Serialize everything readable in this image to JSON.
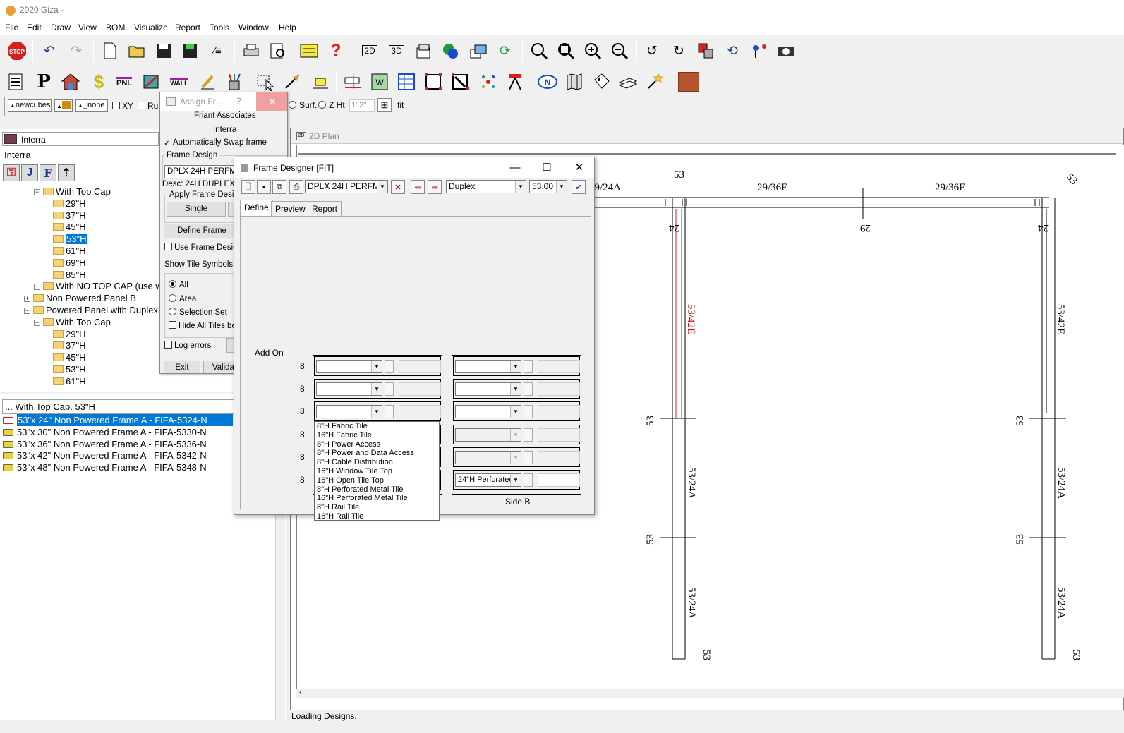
{
  "app": {
    "title": "2020 Giza -"
  },
  "menu": [
    "File",
    "Edit",
    "Draw",
    "View",
    "BOM",
    "Visualize",
    "Report",
    "Tools",
    "Window",
    "Help"
  ],
  "toolbar_icons": [
    "stop-icon",
    "undo-icon",
    "redo-icon",
    "new-icon",
    "open-icon",
    "save-icon",
    "save-as-icon",
    "properties-icon",
    "print-icon",
    "print-preview-icon",
    "notes-icon",
    "help-icon",
    "view-2d-icon",
    "view-3d-icon",
    "layers-icon",
    "globe-icon",
    "windows-icon",
    "refresh-icon",
    "zoom-window-icon",
    "zoom-extents-icon",
    "zoom-in-icon",
    "zoom-out-icon",
    "rotate-left-icon",
    "rotate-right-icon",
    "flip-icon",
    "orbit-icon",
    "pin-icon",
    "snapshot-icon"
  ],
  "toolbar2": {
    "pnl_label": "PNL",
    "wall_label": "WALL",
    "p_label": "P",
    "s_label": "$"
  },
  "layerbar": {
    "layer1": "newcubes",
    "layer3": "_none",
    "xy": "XY",
    "rule": "Rule",
    "surf": "Surf.",
    "zht": "Z Ht",
    "zht_value": "1' 3\"",
    "fit": "fit"
  },
  "left": {
    "combo_value": "Interra",
    "label": "Interra",
    "tree": [
      {
        "text": "With Top Cap",
        "indent": 3,
        "type": "expanded"
      },
      {
        "text": "29\"H",
        "indent": 4
      },
      {
        "text": "37\"H",
        "indent": 4
      },
      {
        "text": "45\"H",
        "indent": 4
      },
      {
        "text": "53\"H",
        "indent": 4,
        "selected": true
      },
      {
        "text": "61\"H",
        "indent": 4
      },
      {
        "text": "69\"H",
        "indent": 4
      },
      {
        "text": "85\"H",
        "indent": 4
      },
      {
        "text": "With NO TOP CAP (use w",
        "indent": 3,
        "type": "collapsed"
      },
      {
        "text": "Non Powered Panel B",
        "indent": 2,
        "type": "collapsed"
      },
      {
        "text": "Powered Panel with Duplex",
        "indent": 2,
        "type": "expanded"
      },
      {
        "text": "With Top Cap",
        "indent": 3,
        "type": "expanded"
      },
      {
        "text": "29\"H",
        "indent": 4
      },
      {
        "text": "37\"H",
        "indent": 4
      },
      {
        "text": "45\"H",
        "indent": 4
      },
      {
        "text": "53\"H",
        "indent": 4
      },
      {
        "text": "61\"H",
        "indent": 4
      }
    ],
    "lower_header": "... With Top Cap. 53\"H",
    "lower_items": [
      {
        "text": "53\"x 24\" Non Powered Frame A - FIFA-5324-N",
        "selected": true
      },
      {
        "text": "53\"x 30\" Non Powered Frame A - FIFA-5330-N"
      },
      {
        "text": "53\"x 36\" Non Powered Frame A - FIFA-5336-N"
      },
      {
        "text": "53\"x 42\" Non Powered Frame A - FIFA-5342-N"
      },
      {
        "text": "53\"x 48\" Non Powered Frame A - FIFA-5348-N"
      }
    ]
  },
  "assign": {
    "title": "Assign Fr...",
    "help": "?",
    "company": "Friant Associates",
    "line": "Interra",
    "auto_swap": "Automatically Swap frame",
    "frame_design_label": "Frame Design",
    "frame_design_value": "DPLX 24H PERFMT",
    "desc": "Desc: 24H DUPLEX P",
    "apply_label": "Apply Frame Design",
    "single": "Single",
    "define_frame": "Define Frame",
    "use_frame": "Use Frame Design",
    "show_tile": "Show Tile Symbols",
    "all": "All",
    "area": "Area",
    "selection_set": "Selection Set",
    "hide_all": "Hide All Tiles be",
    "log_errors": "Log errors",
    "exit": "Exit",
    "validate": "Validat"
  },
  "frame_designer": {
    "title": "Frame Designer [FIT]",
    "design": "DPLX 24H PERFMT",
    "type": "Duplex",
    "height": "53.00",
    "tabs": [
      "Define",
      "Preview",
      "Report"
    ],
    "add_on": "Add On",
    "row_nums": [
      "8",
      "8",
      "8",
      "8",
      "8",
      "8"
    ],
    "side_b": "Side B",
    "side_b_bottom": "24\"H Perforated",
    "dropdown_items": [
      "8\"H Fabric Tile",
      "16\"H Fabric Tile",
      "8\"H Power Access",
      "8\"H Power and Data Access",
      "8\"H Cable Distribution",
      "16\"H Window Tile Top",
      "16\"H Open Tile Top",
      "8\"H Perforated Metal Tile",
      "16\"H Perforated Metal Tile",
      "8\"H Rail Tile",
      "16\"H Rail Tile"
    ]
  },
  "drawing": {
    "title": "2D Plan",
    "labels": {
      "top_left": "29/24A",
      "top_mid1": "29/36E",
      "top_mid2": "29/36E",
      "n53_top": "53",
      "n53_right_top": "53",
      "n24_left": "24",
      "n29_mid": "29",
      "n24_right": "24",
      "left_red": "53/42E",
      "right_42": "53/42E",
      "left_24a_1": "53/24A",
      "right_24a_1": "53/24A",
      "left_24a_2": "53/24A",
      "right_24a_2": "53/24A",
      "j53_l1": "53",
      "j53_r1": "53",
      "j53_l2": "53",
      "j53_r2": "53",
      "end_l": "53",
      "end_r": "53"
    }
  },
  "status": "Loading Designs."
}
